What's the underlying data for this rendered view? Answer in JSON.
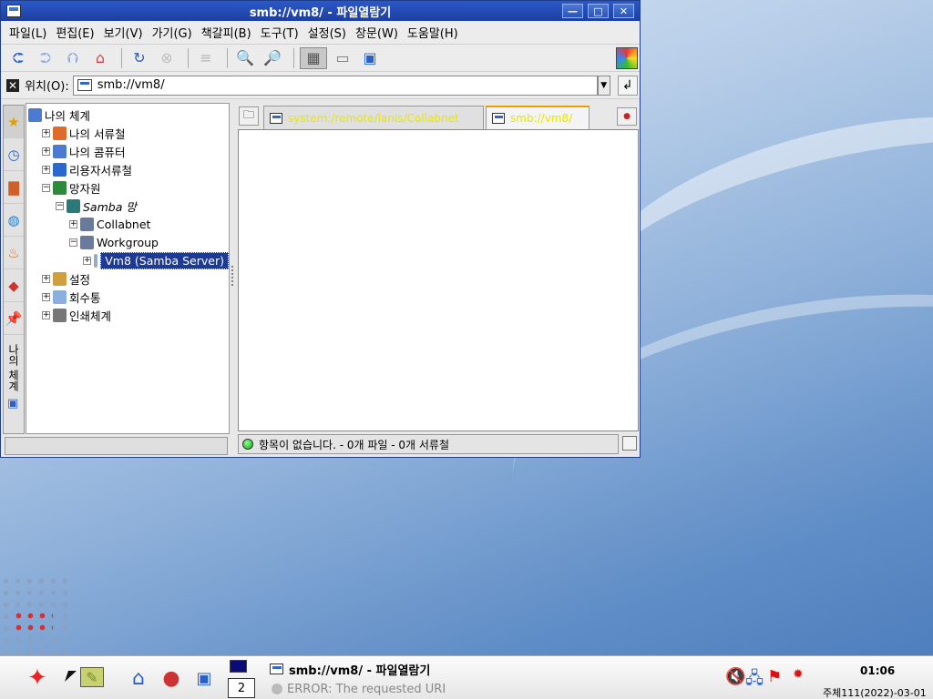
{
  "window": {
    "title": "smb://vm8/ - 파일열람기",
    "controls": {
      "minimize": "—",
      "maximize": "□",
      "close": "✕"
    }
  },
  "menu": [
    "파일(L)",
    "편집(E)",
    "보기(V)",
    "가기(G)",
    "책갈피(B)",
    "도구(T)",
    "설정(S)",
    "창문(W)",
    "도움말(H)"
  ],
  "location": {
    "label": "위치(O):",
    "value": "smb://vm8/"
  },
  "side_panel": {
    "label": "나의 체계"
  },
  "tree": [
    {
      "label": "나의 체계",
      "level": 0,
      "expander": "",
      "color": "#4a7bd0"
    },
    {
      "label": "나의 서류철",
      "level": 1,
      "expander": "+",
      "color": "#e06a2a"
    },
    {
      "label": "나의 콤퓨터",
      "level": 1,
      "expander": "+",
      "color": "#4a7bd0"
    },
    {
      "label": "리용자서류철",
      "level": 1,
      "expander": "+",
      "color": "#2a6ad0"
    },
    {
      "label": "망자원",
      "level": 1,
      "expander": "−",
      "color": "#2d8a3a"
    },
    {
      "label": "Samba 망",
      "level": 2,
      "expander": "−",
      "color": "#2a7a7a",
      "italic": true
    },
    {
      "label": "Collabnet",
      "level": 3,
      "expander": "+",
      "color": "#6a7a9a"
    },
    {
      "label": "Workgroup",
      "level": 3,
      "expander": "−",
      "color": "#6a7a9a"
    },
    {
      "label": "Vm8 (Samba Server)",
      "level": 4,
      "expander": "+",
      "color": "#9ab",
      "selected": true
    },
    {
      "label": "설정",
      "level": 1,
      "expander": "+",
      "color": "#d0a040"
    },
    {
      "label": "회수통",
      "level": 1,
      "expander": "+",
      "color": "#8ab0e0"
    },
    {
      "label": "인쇄체계",
      "level": 1,
      "expander": "+",
      "color": "#777"
    }
  ],
  "tabs": [
    {
      "label": "system:/remote/lanis/Collabnet",
      "active": false
    },
    {
      "label": "smb://vm8/",
      "active": true
    }
  ],
  "status": {
    "text": "항목이 없습니다. - 0개 파일 - 0개 서류철"
  },
  "taskbar": {
    "pager_current": "2",
    "task_title": "smb://vm8/ - 파일열람기",
    "task_error": "ERROR: The requested URL",
    "time": "01:06",
    "date": "주체111(2022)-03-01"
  }
}
